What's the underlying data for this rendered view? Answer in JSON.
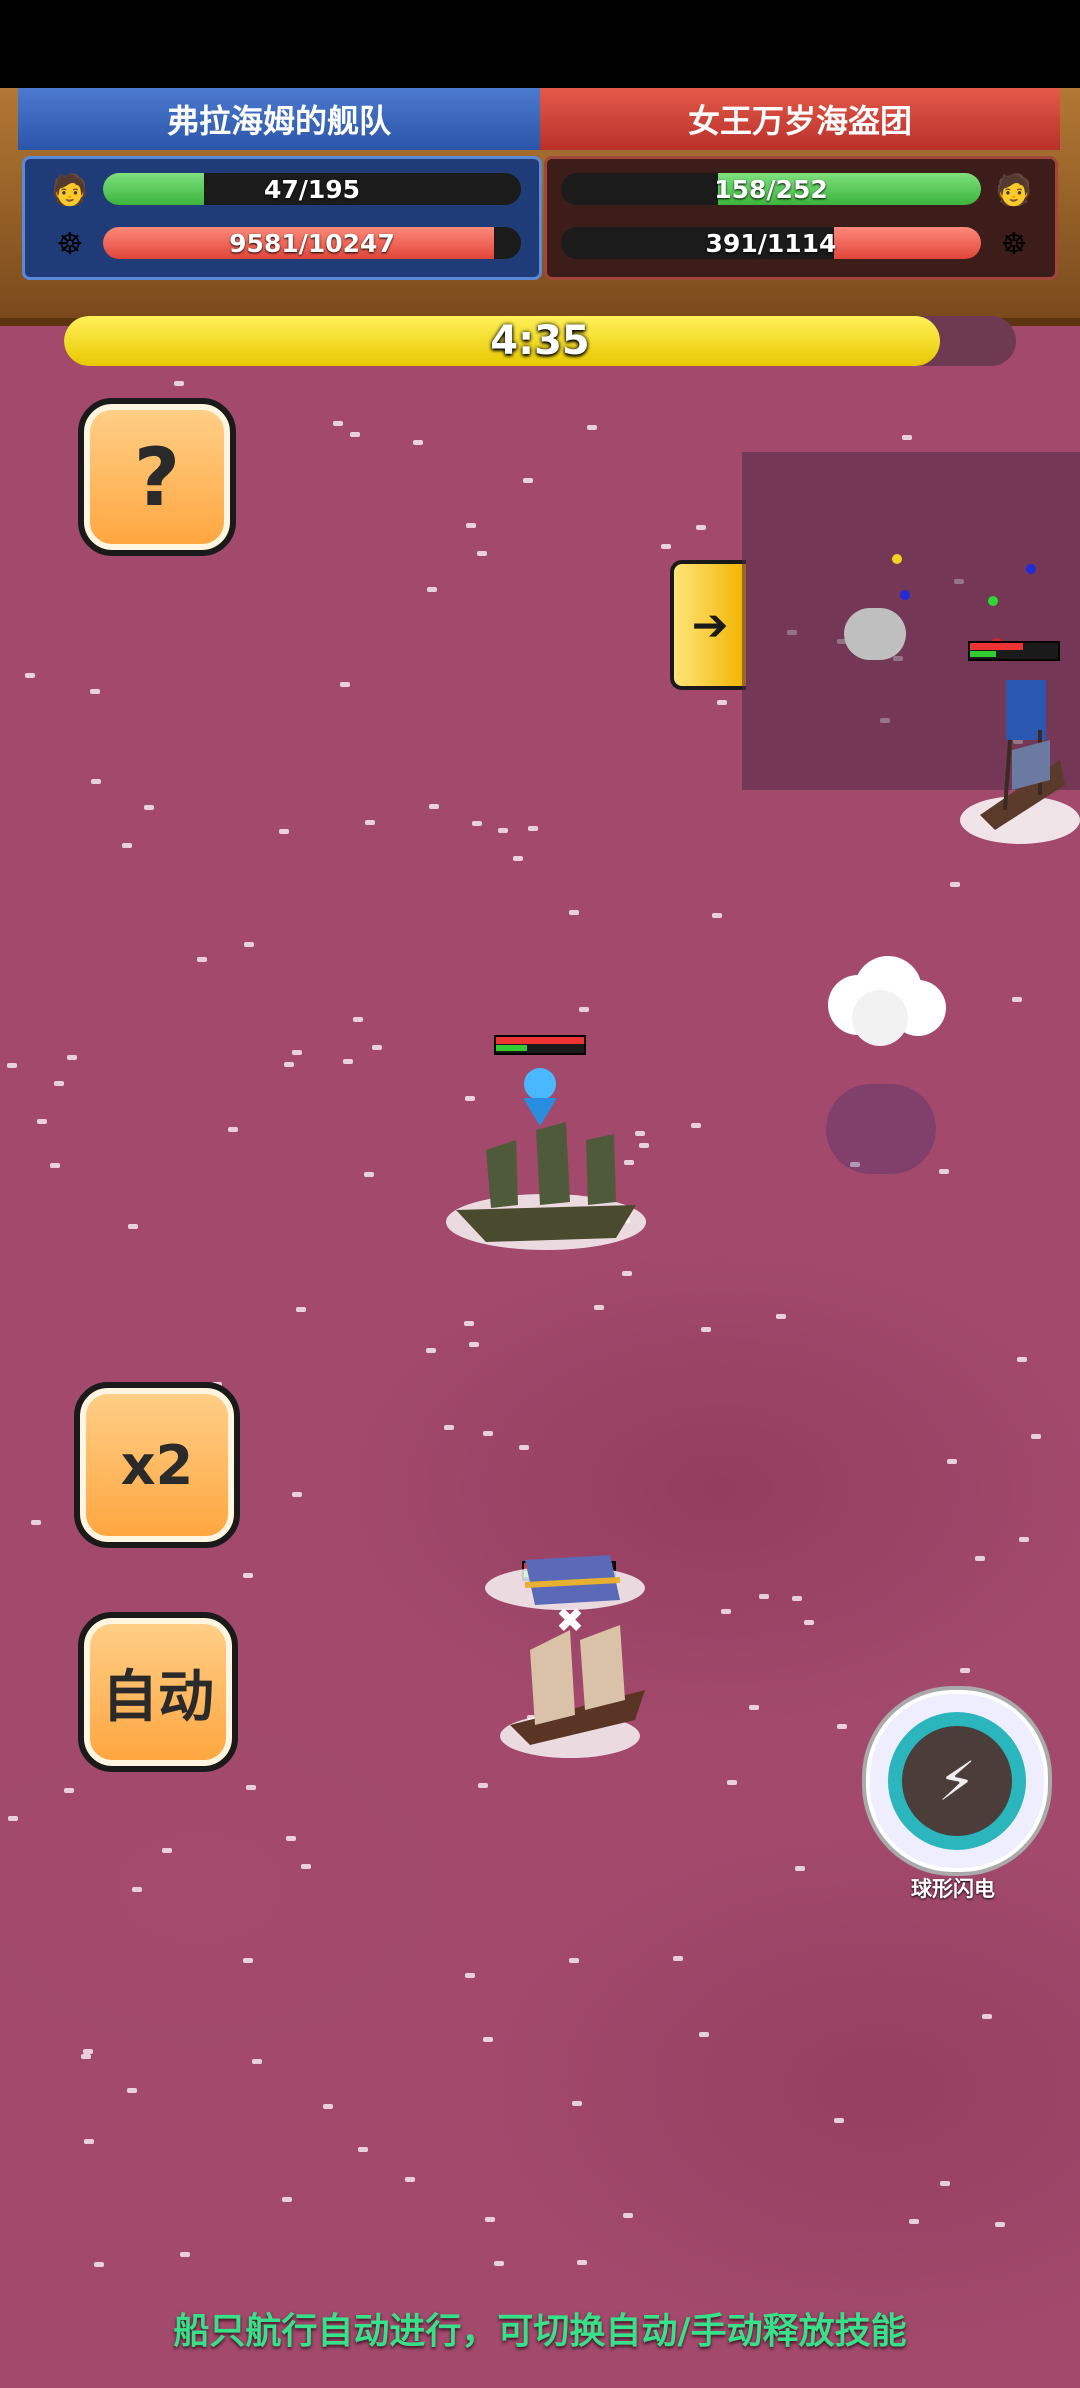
{
  "hud": {
    "left_team": {
      "name": "弗拉海姆的舰队",
      "crew": "47/195",
      "crew_ratio": 0.241,
      "hull": "9581/10247",
      "hull_ratio": 0.935
    },
    "right_team": {
      "name": "女王万岁海盗团",
      "crew": "158/252",
      "crew_ratio": 0.627,
      "hull": "391/1114",
      "hull_ratio": 0.351
    },
    "timer": "4:35",
    "timer_ratio": 0.92
  },
  "buttons": {
    "help": "?",
    "speed": "x2",
    "auto": "自动"
  },
  "skill": {
    "name": "球形闪电",
    "icon": "lightning-sphere-icon"
  },
  "hint": "船只航行自动进行，可切换自动/手动释放技能",
  "minimap": {
    "dots": [
      "#f2d21e",
      "#1e2bd8",
      "#1e2bd8",
      "#2bd830",
      "#e02020"
    ]
  },
  "colors": {
    "sea": "#a2496c",
    "hint_text": "#39e08a",
    "blue_team": "#2b55a8",
    "red_team": "#b8302a"
  }
}
